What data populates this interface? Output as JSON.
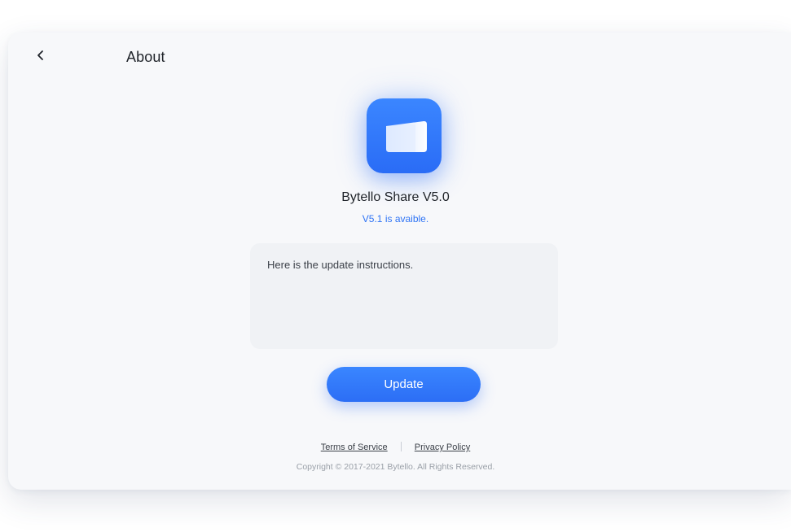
{
  "header": {
    "title": "About"
  },
  "app": {
    "icon": "screen-share-app-icon",
    "name": "Bytello Share V5.0",
    "update_available": "V5.1 is avaible."
  },
  "update_notes": {
    "text": "Here is the update instructions."
  },
  "actions": {
    "update_label": "Update"
  },
  "footer": {
    "terms_label": "Terms of Service",
    "privacy_label": "Privacy Policy",
    "copyright": "Copyright © 2017-2021 Bytello. All Rights Reserved."
  },
  "colors": {
    "accent": "#2f74f5",
    "background": "#f7f8fa",
    "notes_background": "#f0f2f5"
  }
}
